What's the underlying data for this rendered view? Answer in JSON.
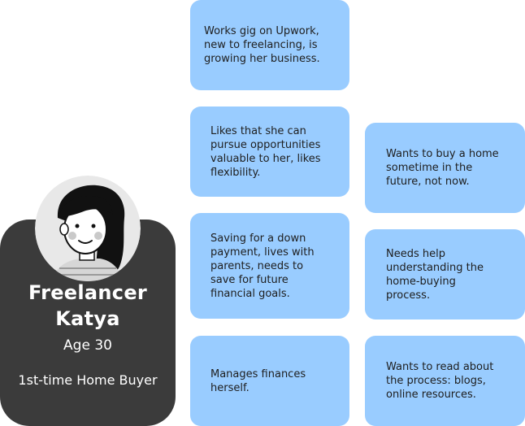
{
  "persona": {
    "name": "Freelancer\nKatya",
    "age": "Age 30",
    "role": "1st-time Home Buyer"
  },
  "colors": {
    "card": "#3b3b3b",
    "note": "#99ccff",
    "avatar_bg": "#e8e8e8"
  },
  "notes": {
    "column1": [
      {
        "text": "Works gig on Upwork,\nnew to freelancing, is\ngrowing her business."
      },
      {
        "text": "Likes that she can\npursue opportunities\nvaluable to her, likes\nflexibility."
      },
      {
        "text": "Saving for a down\npayment, lives with\nparents, needs to\nsave for future\nfinancial goals."
      },
      {
        "text": "Manages finances\nherself."
      }
    ],
    "column2": [
      {
        "text": "Wants to buy a home\nsometime in the\nfuture, not now."
      },
      {
        "text": "Needs help\nunderstanding the\nhome-buying\nprocess."
      },
      {
        "text": "Wants to read about\nthe process: blogs,\nonline resources."
      }
    ]
  }
}
